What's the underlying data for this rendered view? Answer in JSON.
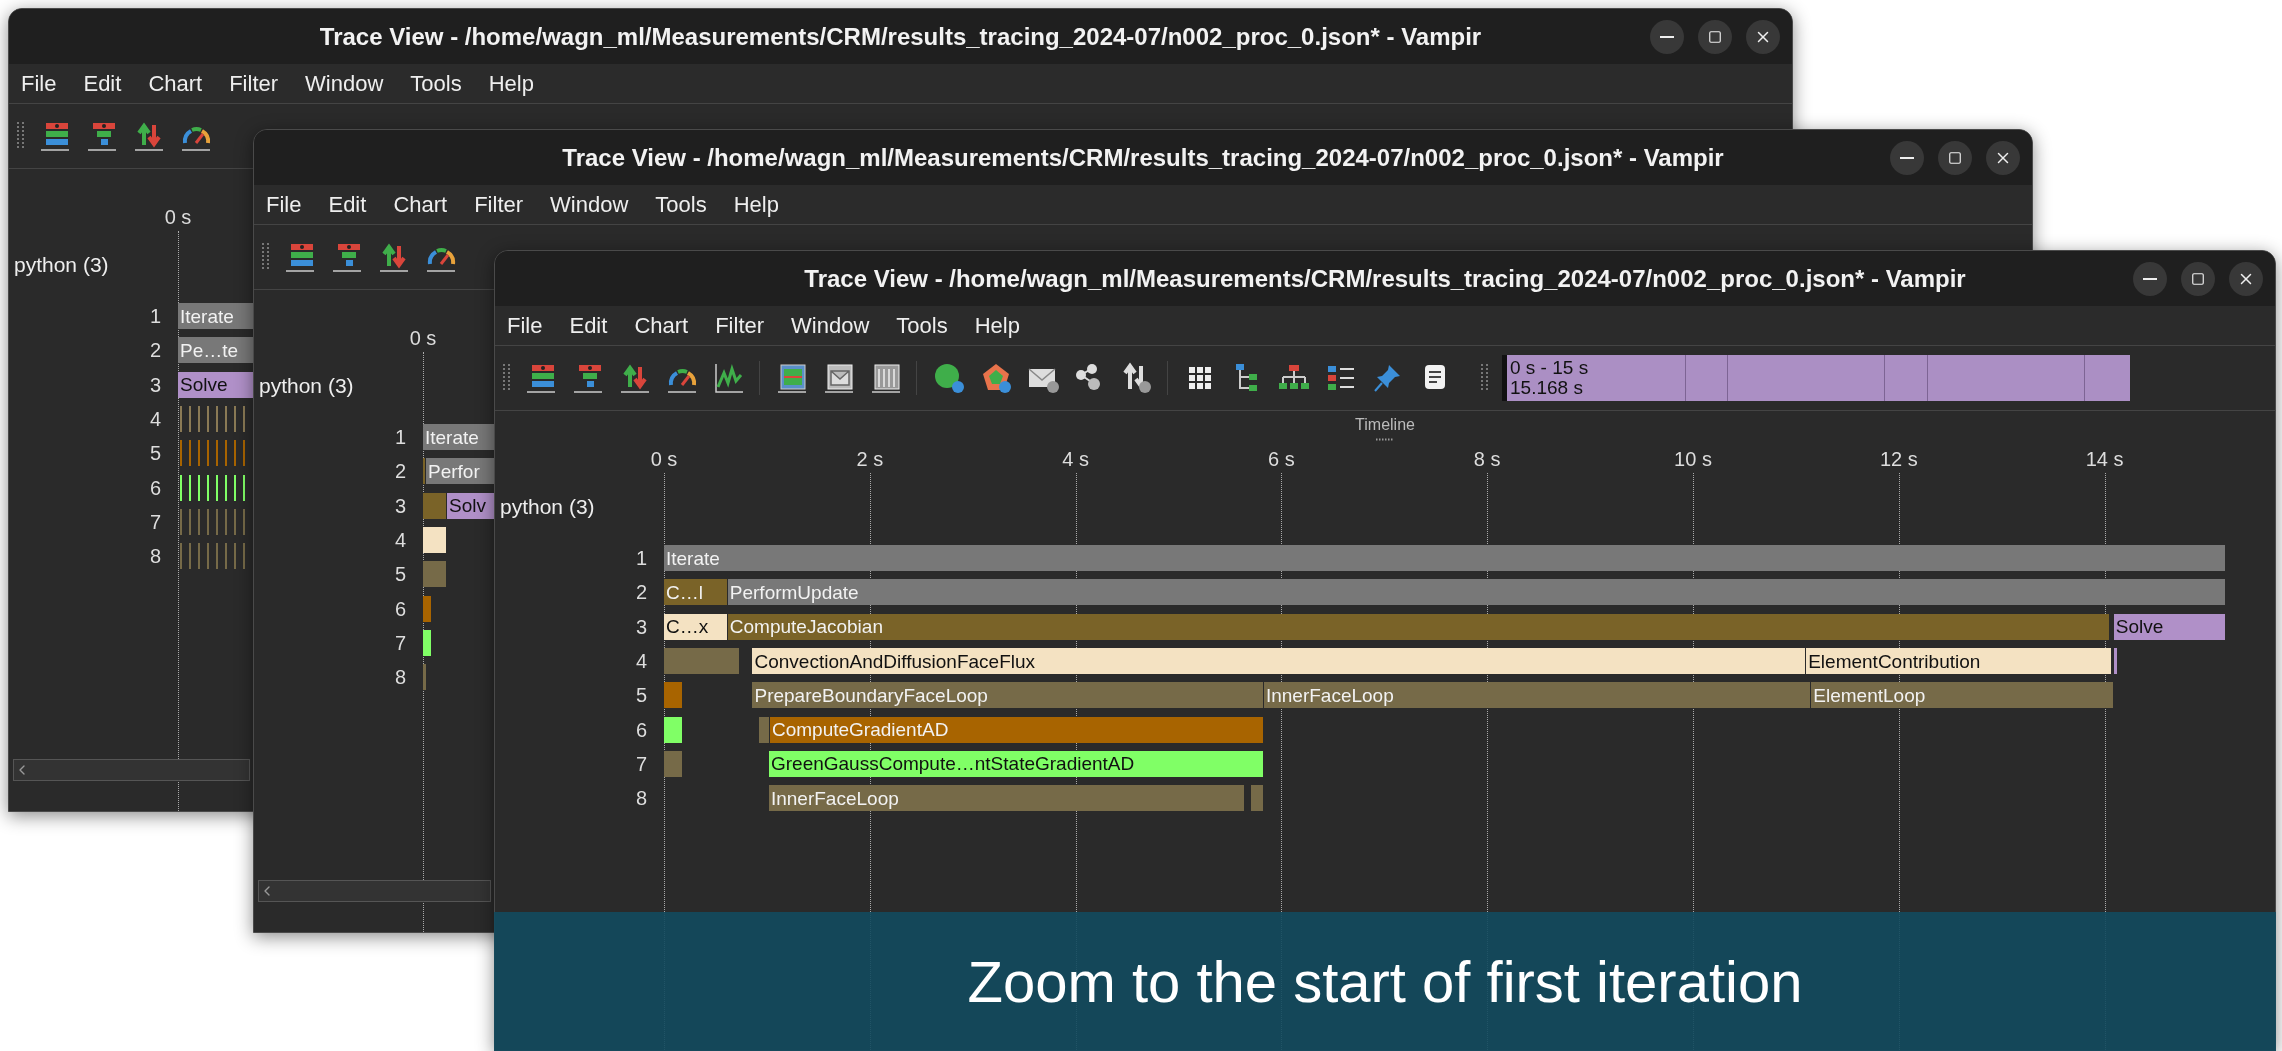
{
  "windows": [
    {
      "title": "Trace View - /home/wagn_ml/Measurements/CRM/results_tracing_2024-07/n002_proc_0.json* - Vampir",
      "menu": [
        "File",
        "Edit",
        "Chart",
        "Filter",
        "Window",
        "Tools",
        "Help"
      ],
      "ticks": [
        "0 s"
      ],
      "process": "python (3)",
      "rows": [
        {
          "label": "1",
          "bars": [
            {
              "kind": "bar",
              "text": "Iterate",
              "color": "#787878"
            }
          ]
        },
        {
          "label": "2",
          "bars": [
            {
              "kind": "bar",
              "text": "Pe…te",
              "color": "#787878"
            }
          ]
        },
        {
          "label": "3",
          "bars": [
            {
              "kind": "bar",
              "text": "Solve",
              "color": "#b090c8"
            }
          ]
        },
        {
          "label": "4",
          "bars": [
            {
              "kind": "stripes",
              "color": "#8a7a55"
            }
          ]
        },
        {
          "label": "5",
          "bars": [
            {
              "kind": "stripes",
              "color": "#a86400"
            }
          ]
        },
        {
          "label": "6",
          "bars": [
            {
              "kind": "stripes",
              "color": "#80ff66"
            }
          ]
        },
        {
          "label": "7",
          "bars": [
            {
              "kind": "stripes",
              "color": "#766a48"
            }
          ]
        },
        {
          "label": "8",
          "bars": [
            {
              "kind": "stripes",
              "color": "#766a48"
            }
          ]
        }
      ]
    },
    {
      "title": "Trace View - /home/wagn_ml/Measurements/CRM/results_tracing_2024-07/n002_proc_0.json* - Vampir",
      "menu": [
        "File",
        "Edit",
        "Chart",
        "Filter",
        "Window",
        "Tools",
        "Help"
      ],
      "ticks": [
        "0 s"
      ],
      "process": "python (3)",
      "rows": [
        {
          "label": "1",
          "bars": [
            {
              "kind": "bar",
              "text": "Iterate",
              "color": "#787878"
            }
          ]
        },
        {
          "label": "2",
          "bars": [
            {
              "kind": "bar",
              "color": "#7a6328"
            },
            {
              "kind": "bar",
              "text": "Perfor",
              "color": "#787878"
            }
          ]
        },
        {
          "label": "3",
          "bars": [
            {
              "kind": "bar",
              "color": "#7a6328"
            },
            {
              "kind": "bar",
              "text": "Solv",
              "color": "#b090c8"
            }
          ]
        },
        {
          "label": "4",
          "bars": [
            {
              "kind": "bar",
              "color": "#f4e2c2"
            }
          ]
        },
        {
          "label": "5",
          "bars": [
            {
              "kind": "bar",
              "color": "#766a48"
            }
          ]
        },
        {
          "label": "6",
          "bars": [
            {
              "kind": "bar",
              "color": "#a86400"
            }
          ]
        },
        {
          "label": "7",
          "bars": [
            {
              "kind": "bar",
              "color": "#80ff66"
            }
          ]
        },
        {
          "label": "8",
          "bars": [
            {
              "kind": "bar",
              "color": "#766a48"
            }
          ]
        }
      ]
    },
    {
      "title": "Trace View - /home/wagn_ml/Measurements/CRM/results_tracing_2024-07/n002_proc_0.json* - Vampir",
      "menu": [
        "File",
        "Edit",
        "Chart",
        "Filter",
        "Window",
        "Tools",
        "Help"
      ],
      "zoom_bar": {
        "range": "0 s - 15 s",
        "duration": "15.168 s"
      },
      "timeline_title": "Timeline",
      "ticks": [
        "0 s",
        "2 s",
        "4 s",
        "6 s",
        "8 s",
        "10 s",
        "12 s",
        "14 s"
      ],
      "process": "python (3)",
      "rows": [
        {
          "label": "1",
          "bars": [
            {
              "kind": "bar",
              "text": "Iterate",
              "color": "#787878"
            }
          ]
        },
        {
          "label": "2",
          "bars": [
            {
              "kind": "bar",
              "text": "C…l",
              "color": "#7a6328"
            },
            {
              "kind": "bar",
              "text": "PerformUpdate",
              "color": "#787878"
            }
          ]
        },
        {
          "label": "3",
          "bars": [
            {
              "kind": "bar",
              "text": "C…x",
              "color": "#f4e2c2"
            },
            {
              "kind": "bar",
              "text": "ComputeJacobian",
              "color": "#7a6328"
            },
            {
              "kind": "bar",
              "text": "Solve",
              "color": "#b090c8"
            }
          ]
        },
        {
          "label": "4",
          "bars": [
            {
              "kind": "bar",
              "color": "#766a48"
            },
            {
              "kind": "bar",
              "text": "ConvectionAndDiffusionFaceFlux",
              "color": "#f4e2c2"
            },
            {
              "kind": "bar",
              "text": "ElementContribution",
              "color": "#f4e2c2"
            },
            {
              "kind": "bar",
              "color": "#b090c8"
            }
          ]
        },
        {
          "label": "5",
          "bars": [
            {
              "kind": "bar",
              "color": "#a86400"
            },
            {
              "kind": "bar",
              "text": "PrepareBoundaryFaceLoop",
              "color": "#766a48"
            },
            {
              "kind": "bar",
              "text": "InnerFaceLoop",
              "color": "#766a48"
            },
            {
              "kind": "bar",
              "text": "ElementLoop",
              "color": "#766a48"
            }
          ]
        },
        {
          "label": "6",
          "bars": [
            {
              "kind": "bar",
              "color": "#80ff66"
            },
            {
              "kind": "bar",
              "color": "#766a48"
            },
            {
              "kind": "bar",
              "text": "ComputeGradientAD",
              "color": "#a86400"
            }
          ]
        },
        {
          "label": "7",
          "bars": [
            {
              "kind": "bar",
              "color": "#766a48"
            },
            {
              "kind": "bar",
              "text": "GreenGaussCompute…ntStateGradientAD",
              "color": "#80ff66"
            }
          ]
        },
        {
          "label": "8",
          "bars": [
            {
              "kind": "bar",
              "text": "InnerFaceLoop",
              "color": "#766a48"
            },
            {
              "kind": "bar",
              "color": "#766a48"
            }
          ]
        }
      ]
    }
  ],
  "caption": "Zoom to the start of first iteration"
}
